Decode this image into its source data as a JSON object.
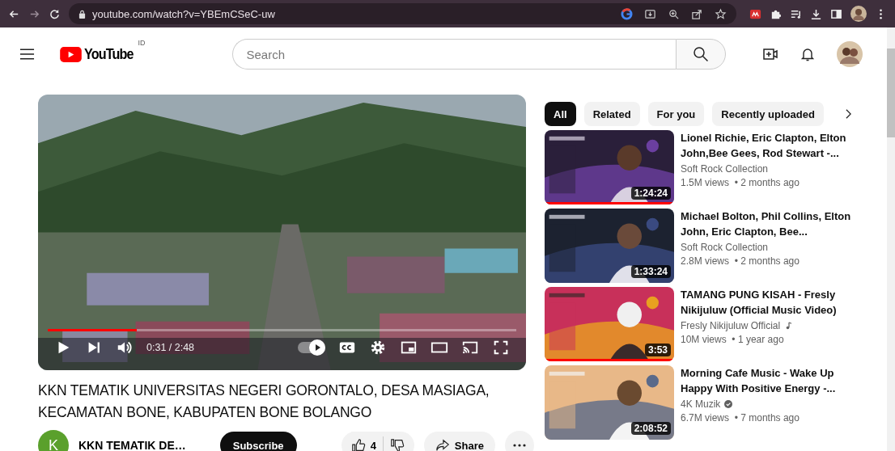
{
  "browser": {
    "url": "youtube.com/watch?v=YBEmCSeC-uw"
  },
  "header": {
    "logo": "YouTube",
    "region": "ID",
    "search": {
      "placeholder": "Search"
    }
  },
  "player": {
    "progress": {
      "level": 0.19
    },
    "time": "0:31 / 2:48",
    "autoplay": true
  },
  "video": {
    "title": "KKN TEMATIK UNIVERSITAS NEGERI GORONTALO, DESA MASIAGA, KECAMATAN BONE, KABUPATEN BONE BOLANGO",
    "channel": {
      "initial": "K",
      "name": "KKN TEMATIK DE…"
    },
    "subscribe": "Subscribe",
    "likes": "4",
    "share": "Share"
  },
  "chips": [
    {
      "label": "All",
      "selected": true
    },
    {
      "label": "Related",
      "selected": false
    },
    {
      "label": "For you",
      "selected": false
    },
    {
      "label": "Recently uploaded",
      "selected": false
    }
  ],
  "recommendations": [
    {
      "title": "Lionel Richie, Eric Clapton, Elton John,Bee Gees, Rod Stewart -...",
      "channel": "Soft Rock Collection",
      "music_badge": false,
      "verified_badge": false,
      "meta": "1.5M views  • 2 months ago",
      "duration": "1:24:24",
      "watched": true
    },
    {
      "title": "Michael Bolton, Phil Collins, Elton John, Eric Clapton, Bee...",
      "channel": "Soft Rock Collection",
      "music_badge": false,
      "verified_badge": false,
      "meta": "2.8M views  • 2 months ago",
      "duration": "1:33:24",
      "watched": false
    },
    {
      "title": "TAMANG PUNG KISAH - Fresly Nikijuluw (Official Music Video)",
      "channel": "Fresly Nikijuluw Official",
      "music_badge": true,
      "verified_badge": false,
      "meta": "10M views  • 1 year ago",
      "duration": "3:53",
      "watched": true
    },
    {
      "title": "Morning Cafe Music - Wake Up Happy With Positive Energy -...",
      "channel": "4K Muzik",
      "music_badge": false,
      "verified_badge": true,
      "meta": "6.7M views  • 7 months ago",
      "duration": "2:08:52",
      "watched": false
    }
  ]
}
